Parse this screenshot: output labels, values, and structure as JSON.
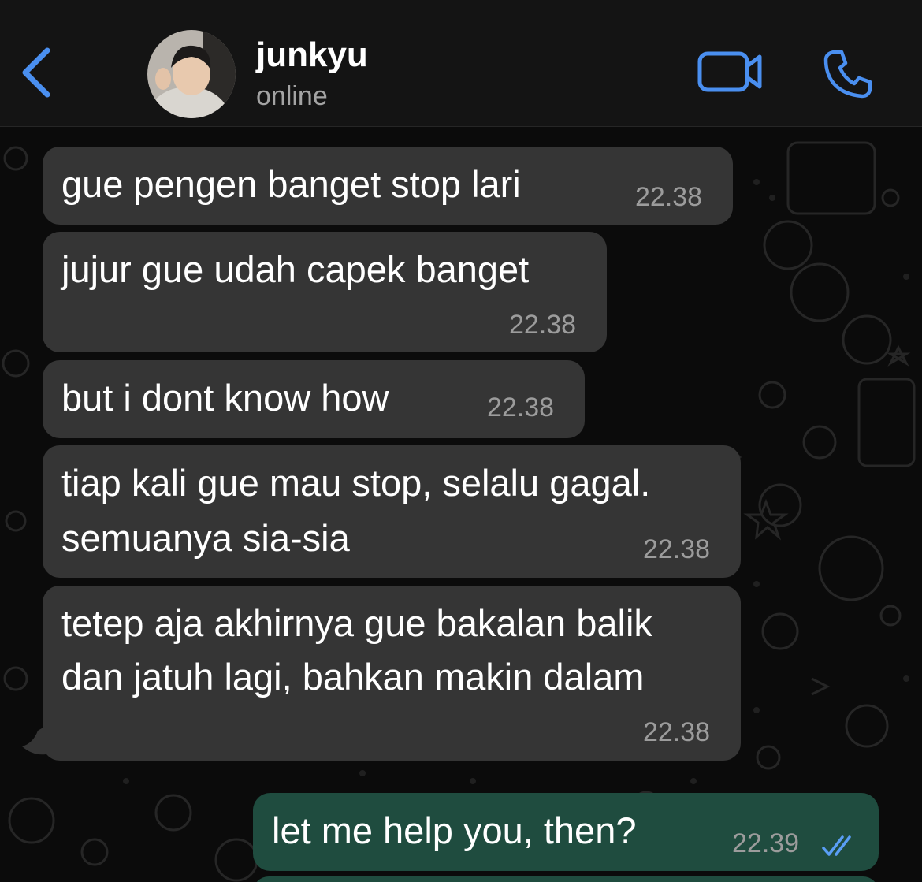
{
  "header": {
    "back_icon": "chevron-left-icon",
    "contact_name": "junkyu",
    "contact_status": "online",
    "video_icon": "video-camera-icon",
    "call_icon": "phone-icon",
    "accent_color": "#4a8ff0"
  },
  "messages": [
    {
      "direction": "incoming",
      "lines": [
        "gue pengen banget stop lari"
      ],
      "time": "22.38"
    },
    {
      "direction": "incoming",
      "lines": [
        "jujur gue udah capek banget"
      ],
      "time": "22.38"
    },
    {
      "direction": "incoming",
      "lines": [
        "but i dont know how"
      ],
      "time": "22.38"
    },
    {
      "direction": "incoming",
      "lines": [
        "tiap kali gue mau stop, selalu gagal.",
        "semuanya sia-sia"
      ],
      "time": "22.38"
    },
    {
      "direction": "incoming",
      "lines": [
        "tetep aja akhirnya gue bakalan balik",
        "dan jatuh lagi, bahkan makin dalam"
      ],
      "time": "22.38"
    },
    {
      "direction": "outgoing",
      "lines": [
        "let me help you, then?"
      ],
      "time": "22.39",
      "status_icon": "double-check-read-icon"
    }
  ],
  "colors": {
    "incoming_bubble": "#353535",
    "outgoing_bubble": "#1f4c3f",
    "read_ticks": "#5a9ef5"
  }
}
